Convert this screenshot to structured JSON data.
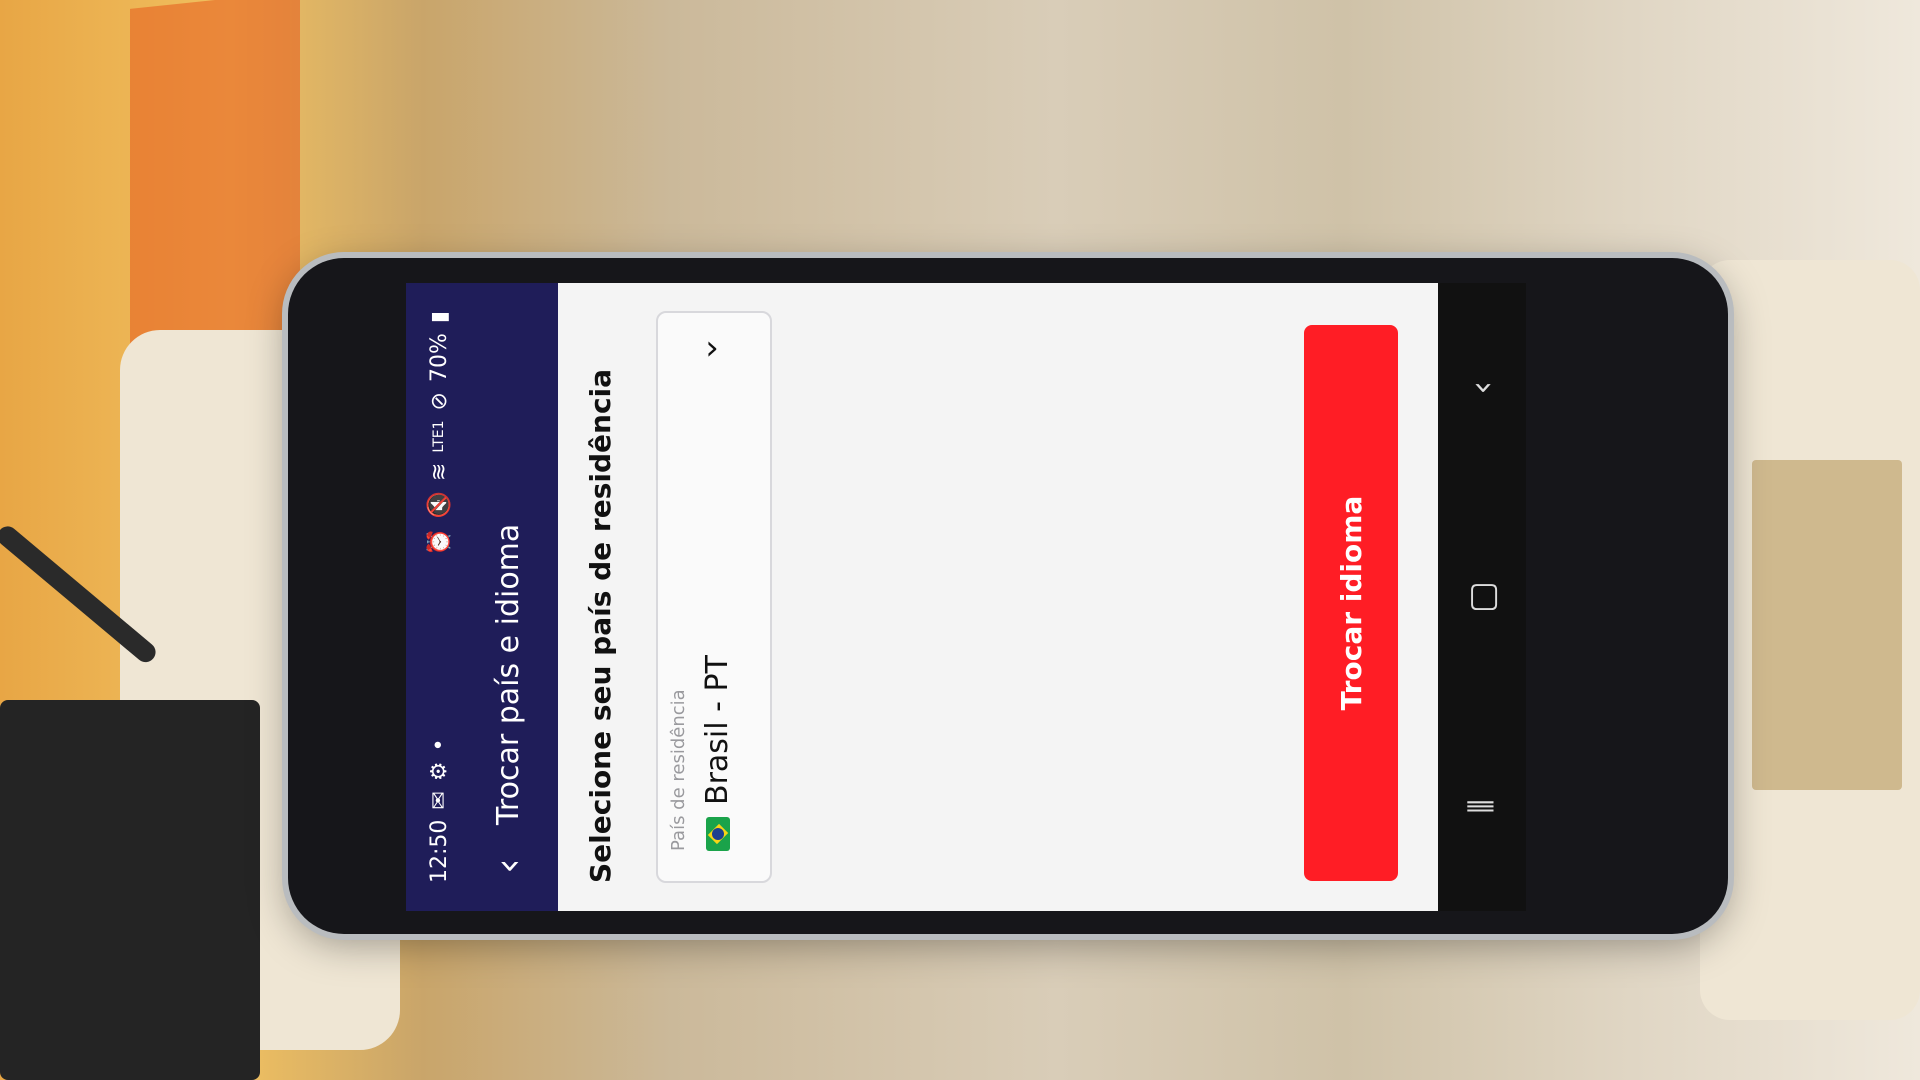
{
  "status_bar": {
    "time": "12:50",
    "battery": "70%",
    "network": "LTE1"
  },
  "header": {
    "back_icon": "chevron-left-icon",
    "title": "Trocar país e idioma"
  },
  "content": {
    "section_title": "Selecione seu país de residência",
    "country_field": {
      "label": "País de residência",
      "value": "Brasil - PT",
      "flag_icon": "brazil-flag-icon",
      "chevron_icon": "chevron-down-icon"
    },
    "primary_button_label": "Trocar idioma"
  },
  "navbar": {
    "recents_icon": "recents-icon",
    "home_icon": "home-icon",
    "back_icon": "back-icon"
  },
  "colors": {
    "header_bg": "#1f1d59",
    "primary_button": "#ff1d25",
    "screen_bg": "#f4f4f4"
  }
}
